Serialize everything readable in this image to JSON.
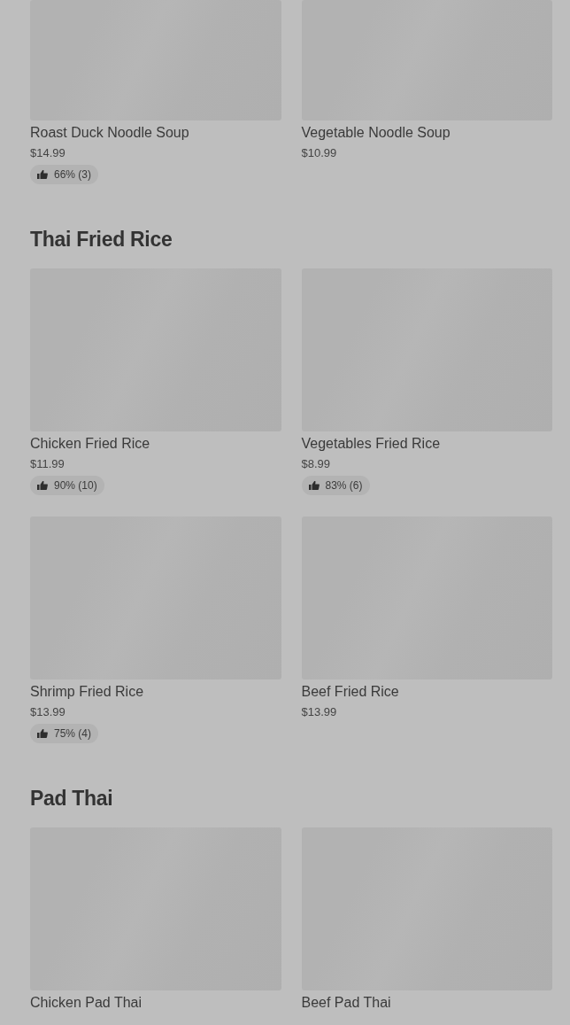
{
  "sections": [
    {
      "items": [
        {
          "name": "Roast Duck Noodle Soup",
          "price": "$14.99",
          "rating": "66% (3)"
        },
        {
          "name": "Vegetable Noodle Soup",
          "price": "$10.99"
        }
      ]
    },
    {
      "heading": "Thai Fried Rice",
      "items": [
        {
          "name": "Chicken Fried Rice",
          "price": "$11.99",
          "rating": "90% (10)"
        },
        {
          "name": "Vegetables Fried Rice",
          "price": "$8.99",
          "rating": "83% (6)"
        },
        {
          "name": "Shrimp Fried Rice",
          "price": "$13.99",
          "rating": "75% (4)"
        },
        {
          "name": "Beef Fried Rice",
          "price": "$13.99"
        }
      ]
    },
    {
      "heading": "Pad Thai",
      "items": [
        {
          "name": "Chicken Pad Thai"
        },
        {
          "name": "Beef Pad Thai"
        }
      ]
    }
  ]
}
